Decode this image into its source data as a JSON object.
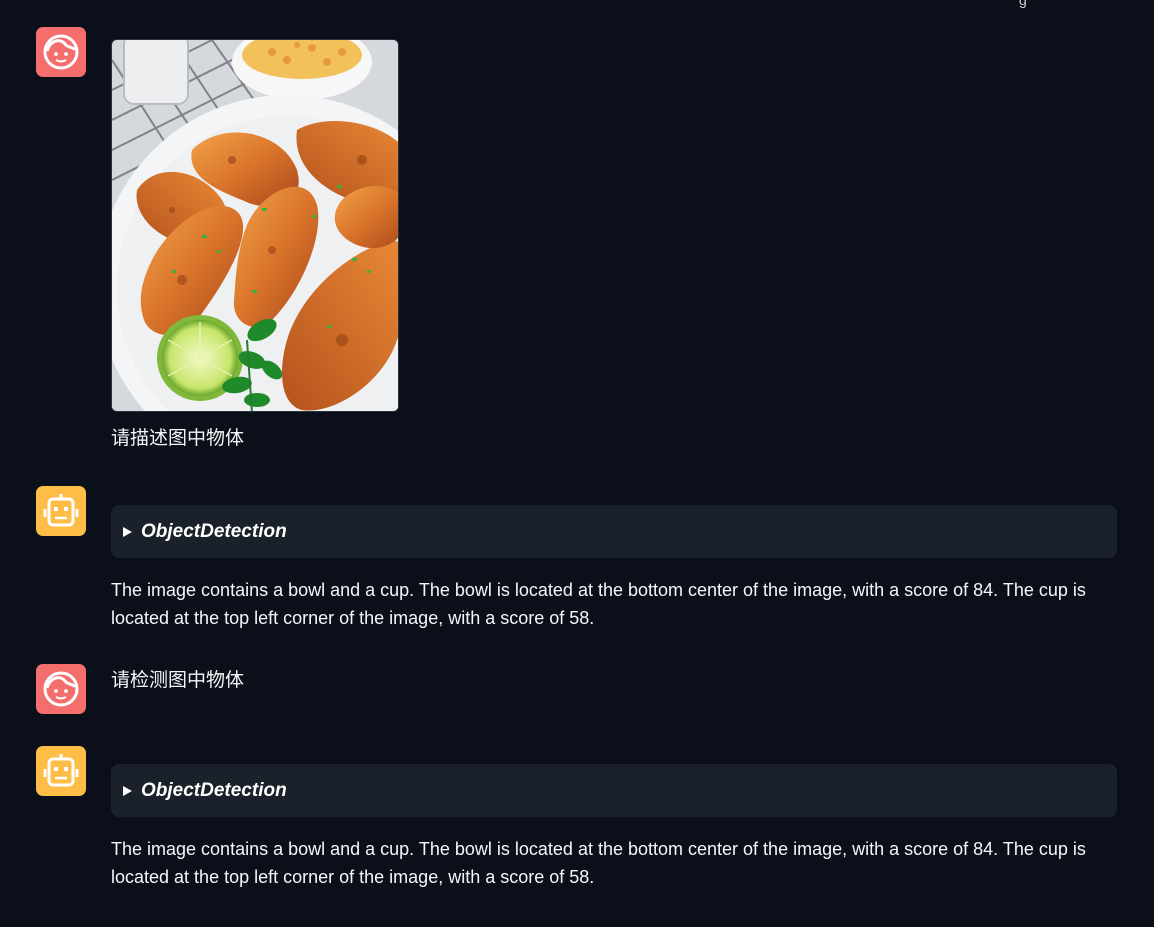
{
  "top_fragment": "g",
  "messages": [
    {
      "role": "user",
      "avatar_icon": "user-face-icon",
      "image": "fried-chicken-wings-photo",
      "text": "请描述图中物体"
    },
    {
      "role": "assistant",
      "avatar_icon": "robot-face-icon",
      "tool_label": "ObjectDetection",
      "text": "The image contains a bowl and a cup. The bowl is located at the bottom center of the image, with a score of 84. The cup is located at the top left corner of the image, with a score of 58."
    },
    {
      "role": "user",
      "avatar_icon": "user-face-icon",
      "text": "请检测图中物体"
    },
    {
      "role": "assistant",
      "avatar_icon": "robot-face-icon",
      "tool_label": "ObjectDetection",
      "text": "The image contains a bowl and a cup. The bowl is located at the bottom center of the image, with a score of 84. The cup is located at the top left corner of the image, with a score of 58."
    }
  ],
  "colors": {
    "background": "#0b0f19",
    "user_avatar": "#f46e6e",
    "bot_avatar": "#fdbd46",
    "tool_panel": "#1a212b"
  }
}
